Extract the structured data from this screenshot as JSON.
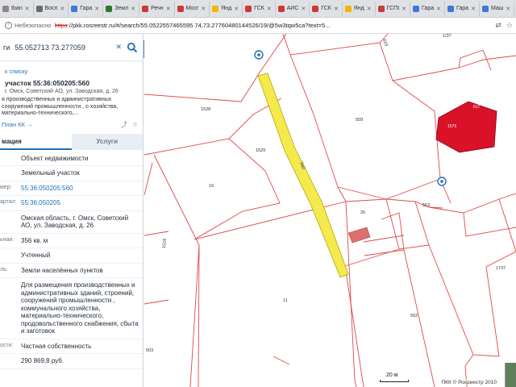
{
  "browser": {
    "tabs": [
      {
        "label": "tban",
        "color": "#888888"
      },
      {
        "label": "Восп",
        "color": "#6b6b6b"
      },
      {
        "label": "Гара",
        "color": "#3a7bd5"
      },
      {
        "label": "Земл",
        "color": "#2a7a2a"
      },
      {
        "label": "Речн",
        "color": "#c93a3a"
      },
      {
        "label": "Мосг",
        "color": "#c93a3a"
      },
      {
        "label": "Янд",
        "color": "#f2b600"
      },
      {
        "label": "ГСК",
        "color": "#c93a3a"
      },
      {
        "label": "АИС",
        "color": "#c93a3a"
      },
      {
        "label": "ГСК",
        "color": "#c93a3a"
      },
      {
        "label": "Янд",
        "color": "#f2b600"
      },
      {
        "label": "ГСПІ",
        "color": "#c93a3a"
      },
      {
        "label": "Гара",
        "color": "#3a7bd5"
      },
      {
        "label": "Гара",
        "color": "#3a7bd5"
      },
      {
        "label": "Маш",
        "color": "#3a7bd5"
      },
      {
        "label": "Гара",
        "color": "#3a7bd5"
      },
      {
        "label": "Гара",
        "color": "#3a7bd5"
      },
      {
        "label": "Учас",
        "color": "#3a7bd5"
      },
      {
        "label": "Рамі",
        "color": "#3a7bd5"
      }
    ],
    "insecure_label": "Небезопасно",
    "url_scheme": "https",
    "url_rest": "://pkk.rosreestr.ru/#/search/55.0522557465595 74,73.27760480144526/19/@5w3tqw5ca?text=5..."
  },
  "panel": {
    "search_prefix": "ги",
    "search_value": "55.052713 73.277059",
    "search_placeholder": "Поиск",
    "back_link": "к списку",
    "object_title": "участок 55:36:050205:560",
    "object_subtitle": "г. Омск, Советский АО, ул. Заводская, д. 26",
    "object_description": "я производственных и административных сооружений промышленности , о хозяйства, материально-технического,...",
    "plan_link": "План КК →",
    "tab_info": "мация",
    "tab_services": "Услуги",
    "rows": [
      {
        "key": "",
        "value": "Объект недвижимости",
        "link": false
      },
      {
        "key": "",
        "value": "Земельный участок",
        "link": false
      },
      {
        "key": "мер:",
        "value": "55:36:050205:560",
        "link": true
      },
      {
        "key": "артал:",
        "value": "55:36:050205",
        "link": true
      },
      {
        "key": "",
        "value": "Омская область, г. Омск, Советский АО, ул. Заводская, д. 26",
        "link": false
      },
      {
        "key": "ьная:",
        "value": "356 кв. м",
        "link": false
      },
      {
        "key": "",
        "value": "Учтенный",
        "link": false
      },
      {
        "key": "ль:",
        "value": "Земли населённых пунктов",
        "link": false
      },
      {
        "key": "",
        "value": "Для размещения производственных и административных зданий, строений, сооружений промышленности , коммунального хозяйства, материально-технического, продовольственного снабжения, сбыта и заготовок",
        "link": false
      },
      {
        "key": "ости:",
        "value": "Частная собственность",
        "link": false
      },
      {
        "key": "",
        "value": "290 869,8 руб.",
        "link": false
      }
    ]
  },
  "map": {
    "parcel_labels": {
      "p1528": "1528",
      "p509": "509",
      "p1529": "1529",
      "p10": "10",
      "p26": "26",
      "p563": "563",
      "p1516": "1516",
      "p11": "11",
      "p562": "562",
      "p1737": "1737",
      "p503": "503",
      "p615": "615",
      "p1737top": "1/37",
      "p560": "560",
      "p617": "617",
      "p1575": "1575"
    },
    "scale_label": "20 м",
    "copyright": "ПКК © Росреестр 2010",
    "highlight_color": "#f4ea4e",
    "building_color": "#d9122a",
    "pink_building_color": "#e07070"
  }
}
